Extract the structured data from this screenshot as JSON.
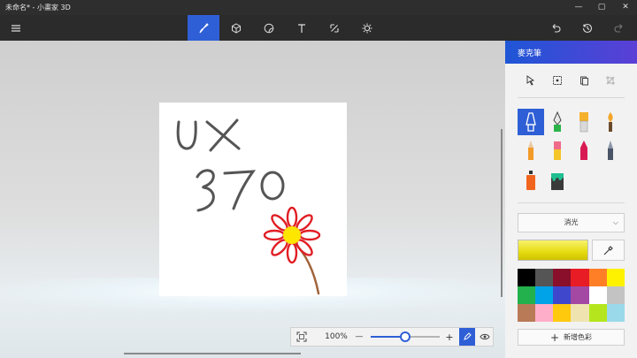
{
  "window": {
    "title": "未命名* - 小畫家 3D",
    "minimize": "—",
    "maximize": "▢",
    "close": "✕"
  },
  "toolbar": {
    "tools": [
      "menu-icon",
      "brush-icon",
      "cube-icon",
      "sticker-icon",
      "text-icon",
      "canvas-icon",
      "effects-icon"
    ],
    "active": "brush-icon",
    "right": [
      "undo-icon",
      "history-icon",
      "redo-icon"
    ]
  },
  "canvas": {
    "ink_color": "#555555",
    "flower_petal_color": "#e01e24",
    "flower_center_color": "#ffe600",
    "stem_color": "#a0643a"
  },
  "zoom": {
    "level": "100%",
    "minus": "—",
    "plus": "+",
    "fraction": 0.5
  },
  "panel": {
    "title": "麥克筆",
    "finish": "消光",
    "current_color": "#f2ea2a",
    "add_color": "新增色彩",
    "palette": [
      "#000000",
      "#555555",
      "#8a0f2a",
      "#e81c24",
      "#ff7f27",
      "#fff200",
      "#22b14c",
      "#00a2e8",
      "#3f48cc",
      "#a349a4",
      "#ffffff",
      "#c3c3c3",
      "#b97a57",
      "#ffaec9",
      "#ffc90e",
      "#efe4b0",
      "#b5e61d",
      "#99d9ea"
    ]
  }
}
